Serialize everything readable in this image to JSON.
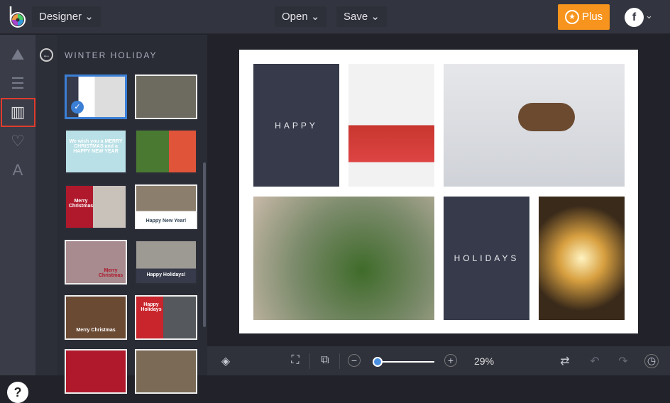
{
  "header": {
    "app_menu": "Designer",
    "open": "Open",
    "save": "Save",
    "plus": "Plus",
    "colors": {
      "plus": "#f7941d",
      "selected_outline": "#e03c2c",
      "accent": "#4a90e2"
    }
  },
  "sidebar": {
    "items": [
      {
        "icon": "image-icon"
      },
      {
        "icon": "sliders-icon"
      },
      {
        "icon": "collage-layout-icon",
        "selected": true
      },
      {
        "icon": "heart-icon"
      },
      {
        "icon": "text-icon"
      }
    ],
    "help": "?"
  },
  "panel": {
    "title": "WINTER HOLIDAY",
    "thumbnails": [
      {
        "label": "",
        "selected": true
      },
      {
        "label": ""
      },
      {
        "label": "We wish you a MERRY CHRISTMAS and a HAPPY NEW YEAR"
      },
      {
        "label": ""
      },
      {
        "label": "Merry Christmas"
      },
      {
        "label": "Happy New Year!"
      },
      {
        "label": "Merry Christmas"
      },
      {
        "label": "Happy Holidays!"
      },
      {
        "label": "Merry Christmas"
      },
      {
        "label": "Happy Holidays"
      },
      {
        "label": ""
      },
      {
        "label": ""
      }
    ]
  },
  "canvas": {
    "tile_happy": "HAPPY",
    "tile_holidays": "HOLIDAYS"
  },
  "bottombar": {
    "zoom": "29%",
    "zoom_fraction": 0.29
  }
}
